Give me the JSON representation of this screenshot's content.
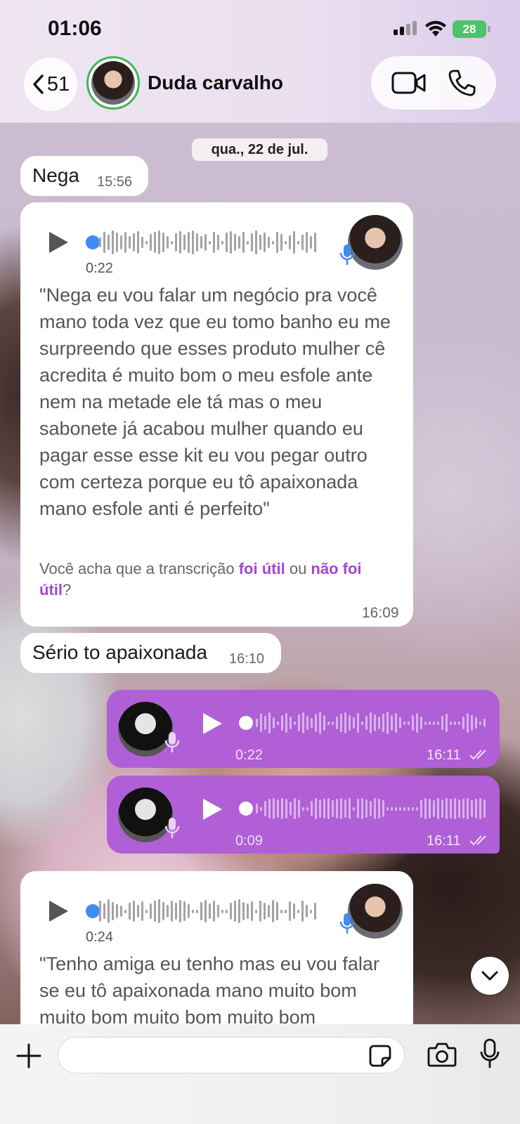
{
  "status_bar": {
    "time": "01:06",
    "battery": "28"
  },
  "header": {
    "back_count": "51",
    "contact_name": "Duda carvalho"
  },
  "date_chip": "qua., 22 de jul.",
  "messages": {
    "m1": {
      "text": "Nega",
      "time": "15:56"
    },
    "m2": {
      "duration": "0:22",
      "transcript": "\"Nega eu vou falar um negócio pra você mano toda vez que eu tomo banho eu me surpreendo que esses produto mulher cê acredita é muito bom o meu esfole ante nem na metade ele tá mas o meu sabonete já acabou mulher quando eu pagar esse esse kit eu vou pegar outro com certeza porque eu tô apaixonada mano esfole anti é perfeito\"",
      "feedback_prefix": "Você acha que a transcrição ",
      "feedback_yes": "foi útil",
      "feedback_or": " ou ",
      "feedback_no": "não foi útil",
      "feedback_end": "?",
      "time": "16:09"
    },
    "m3": {
      "text": "Sério to apaixonada",
      "time": "16:10"
    },
    "m4": {
      "duration": "0:22",
      "time": "16:11"
    },
    "m5": {
      "duration": "0:09",
      "time": "16:11"
    },
    "m6": {
      "duration": "0:24",
      "transcript": "\"Tenho amiga eu tenho mas eu vou falar se eu tô apaixonada mano muito bom muito bom muito bom muito bom"
    }
  },
  "composer": {
    "placeholder": ""
  },
  "colors": {
    "outgoing": "#b05fd6",
    "incoming": "#ffffff",
    "accent_link": "#a347cf",
    "online_ring": "#3fb654"
  },
  "icons": [
    "back-chevron-icon",
    "video-call-icon",
    "phone-call-icon",
    "play-icon",
    "mic-icon",
    "double-check-icon",
    "chevron-down-icon",
    "plus-icon",
    "sticker-icon",
    "camera-icon",
    "microphone-icon"
  ]
}
